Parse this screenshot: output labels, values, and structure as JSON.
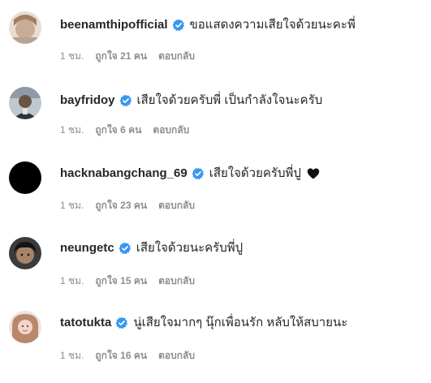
{
  "colors": {
    "verified": "#3897f0",
    "meta_text": "#8e8e8e",
    "body_text": "#262626"
  },
  "comments": [
    {
      "username": "beenamthipofficial",
      "text": "ขอแสดงความเสียใจด้วยนะคะพี่",
      "time": "1 ชม.",
      "likes": "ถูกใจ 21 คน",
      "reply": "ตอบกลับ",
      "verified": true,
      "avatar_icon": "avatar-photo-icon"
    },
    {
      "username": "bayfridoy",
      "text": "เสียใจด้วยครับพี่ เป็นกำลังใจนะครับ",
      "time": "1 ชม.",
      "likes": "ถูกใจ 6 คน",
      "reply": "ตอบกลับ",
      "verified": true,
      "avatar_icon": "avatar-photo-icon"
    },
    {
      "username": "hacknabangchang_69",
      "text": "เสียใจด้วยครับพี่ปู",
      "time": "1 ชม.",
      "likes": "ถูกใจ 23 คน",
      "reply": "ตอบกลับ",
      "verified": true,
      "emoji": "black-heart-icon",
      "avatar_icon": "avatar-black-icon"
    },
    {
      "username": "neungetc",
      "text": "เสียใจด้วยนะครับพี่ปู",
      "time": "1 ชม.",
      "likes": "ถูกใจ 15 คน",
      "reply": "ตอบกลับ",
      "verified": true,
      "avatar_icon": "avatar-photo-icon"
    },
    {
      "username": "tatotukta",
      "text": "นู่เสียใจมากๆ นุ๊กเพื่อนรัก หลับให้สบายนะ",
      "time": "1 ชม.",
      "likes": "ถูกใจ 16 คน",
      "reply": "ตอบกลับ",
      "verified": true,
      "avatar_icon": "avatar-photo-icon"
    }
  ]
}
